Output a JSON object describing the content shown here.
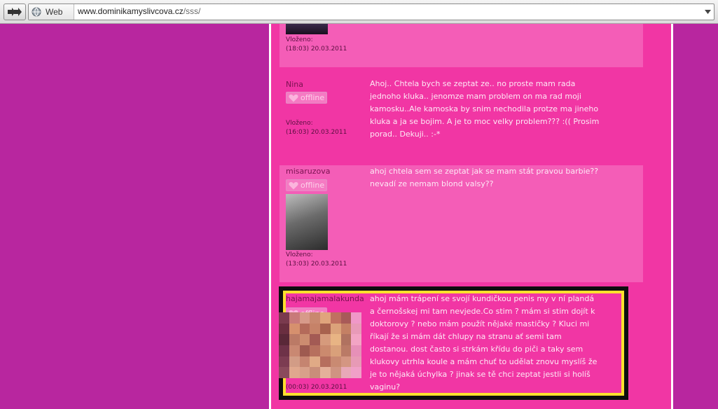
{
  "browser": {
    "go_icon": "double-arrow-right-icon",
    "search_engine_label": "Web",
    "url_domain": "www.dominikamyslivcova.cz",
    "url_path": "/sss/"
  },
  "posts": [
    {
      "posted_label": "Vloženo:",
      "posted_time": "(18:03) 20.03.2011"
    },
    {
      "author": "Nina",
      "status": "offline",
      "posted_label": "Vloženo:",
      "posted_time": "(16:03) 20.03.2011",
      "message": "Ahoj.. Chtela bych se zeptat ze.. no proste mam rada jednoho kluka.. jenomze mam problem on ma rad moji kamosku..Ale kamoska by snim nechodila protze ma jineho kluka a ja se bojim. A je to moc velky problem??? :(( Prosim porad.. Dekuji.. :-*"
    },
    {
      "author": "misaruzova",
      "status": "offline",
      "posted_label": "Vloženo:",
      "posted_time": "(13:03) 20.03.2011",
      "message": "ahoj chtela sem se zeptat jak se mam stát pravou barbie?? nevadí ze nemam blond valsy??"
    },
    {
      "author": "hajamajamalakunda",
      "status": "offline",
      "posted_time": "(00:03) 20.03.2011",
      "message": "ahoj mám trápení se svojí kundičkou penis my v ní plandá a černošskej mi tam nevjede.Co stim ? mám si stim dojít k doktorovy ? nebo mám použít nějaké mastičky ? Kluci mi říkají že si mám dát chlupy na stranu ať semi tam dostanou. dost často si strkám křídu do piči a taky sem klukovy utrhla koule a mám chuť to udělat znovu myslíš že je to nějaká úchylka ? jinak se tě chci zeptat jestli si holíš vaginu?"
    }
  ],
  "colors": {
    "outer_bg": "#b8269f",
    "column_bg": "#f136a4",
    "post_bg": "#f45db7",
    "highlight_border": "#fde02d"
  }
}
